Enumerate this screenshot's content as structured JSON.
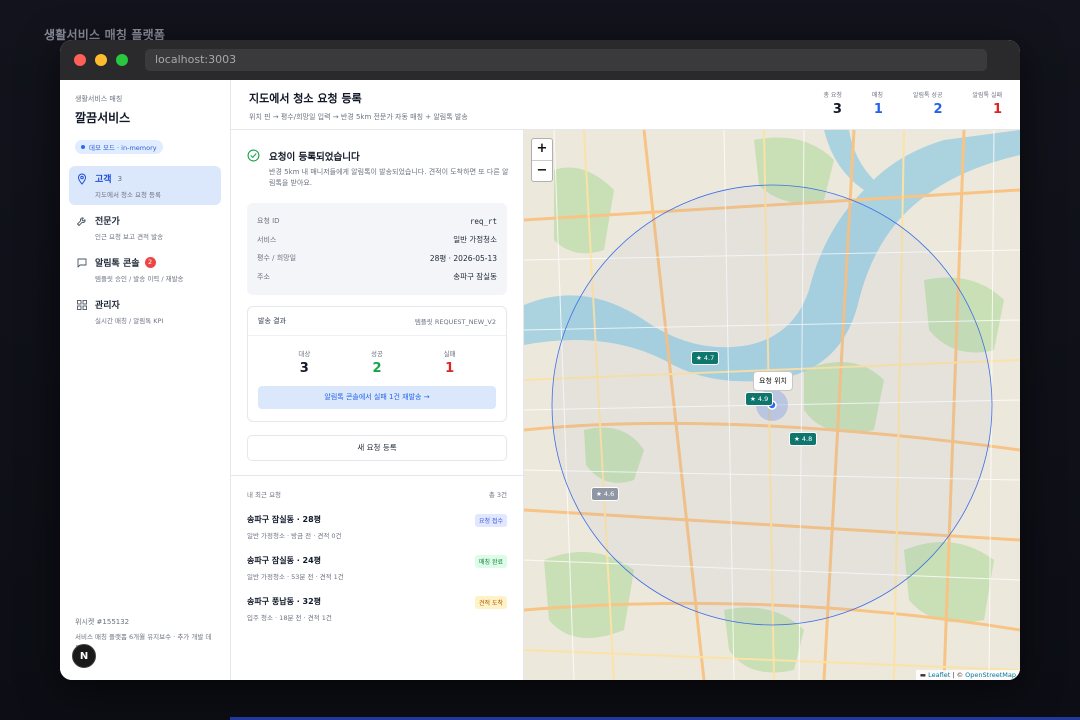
{
  "page": {
    "caption": "생활서비스 매칭 플랫폼"
  },
  "browser": {
    "url": "localhost:3003"
  },
  "sidebar": {
    "brand_small": "생활서비스 매칭",
    "brand_title": "깔끔서비스",
    "demo_badge": "데모 모드 · in-memory",
    "items": [
      {
        "label": "고객",
        "count": "3",
        "sub": "지도에서 청소 요청 등록",
        "icon": "map-pin-icon"
      },
      {
        "label": "전문가",
        "sub": "인근 요청 보고 견적 발송",
        "icon": "wrench-icon"
      },
      {
        "label": "알림톡 콘솔",
        "badge": "2",
        "sub": "템플릿 승인 / 발송 이력 / 재발송",
        "icon": "message-icon"
      },
      {
        "label": "관리자",
        "sub": "실시간 매칭 / 알림톡 KPI",
        "icon": "grid-icon"
      }
    ],
    "footer_title": "위시켓 #155132",
    "footer_desc": "서비스 매칭 플랫폼 6개월 유지보수 · 추가 개발 데모",
    "avatar": "N"
  },
  "header": {
    "title": "지도에서 청소 요청 등록",
    "subtitle": "위치 핀 → 평수/희망일 입력 → 반경 5km 전문가 자동 매칭 + 알림톡 발송",
    "kpis": [
      {
        "label": "총 요청",
        "value": "3",
        "color": "#111827"
      },
      {
        "label": "매칭",
        "value": "1",
        "color": "#2563eb"
      },
      {
        "label": "알림톡 성공",
        "value": "2",
        "color": "#2563eb"
      },
      {
        "label": "알림톡 실패",
        "value": "1",
        "color": "#dc2626"
      }
    ]
  },
  "success": {
    "title": "요청이 등록되었습니다",
    "desc": "반경 5km 내 매니저들에게 알림톡이 발송되었습니다. 견적이 도착하면 또 다른 알림톡을 받아요."
  },
  "request_info": {
    "rows": [
      {
        "k": "요청 ID",
        "v": "req_rt"
      },
      {
        "k": "서비스",
        "v": "일반 가정청소"
      },
      {
        "k": "평수 / 희망일",
        "v": "28평 · 2026-05-13"
      },
      {
        "k": "주소",
        "v": "송파구 잠실동"
      }
    ]
  },
  "send_result": {
    "title": "발송 결과",
    "template": "템플릿 REQUEST_NEW_V2",
    "stats": [
      {
        "label": "대상",
        "value": "3",
        "color": "#111827"
      },
      {
        "label": "성공",
        "value": "2",
        "color": "#16a34a"
      },
      {
        "label": "실패",
        "value": "1",
        "color": "#dc2626"
      }
    ],
    "resend_label": "알림톡 콘솔에서 실패 1건 재발송 →"
  },
  "new_request_label": "새 요청 등록",
  "recent": {
    "title": "내 최근 요청",
    "total": "총 3건",
    "items": [
      {
        "title": "송파구 잠실동 · 28평",
        "sub": "일반 가정청소 · 방금 전 · 견적 0건",
        "tag": "요청 접수",
        "tag_bg": "#e0e7ff",
        "tag_fg": "#3b5bdb"
      },
      {
        "title": "송파구 잠실동 · 24평",
        "sub": "일반 가정청소 · 53분 전 · 견적 1건",
        "tag": "매칭 완료",
        "tag_bg": "#dcfce7",
        "tag_fg": "#15803d"
      },
      {
        "title": "송파구 풍납동 · 32평",
        "sub": "입주 청소 · 18분 전 · 견적 1건",
        "tag": "견적 도착",
        "tag_bg": "#fef3c7",
        "tag_fg": "#b45309"
      }
    ]
  },
  "map": {
    "zoom_in": "+",
    "zoom_out": "−",
    "location_label": "요청 위치",
    "ratings": [
      "★ 4.7",
      "★ 4.9",
      "★ 4.8",
      "★ 4.6"
    ],
    "attribution_leaflet": "Leaflet",
    "attribution_sep": " | © ",
    "attribution_osm": "OpenStreetMap"
  }
}
